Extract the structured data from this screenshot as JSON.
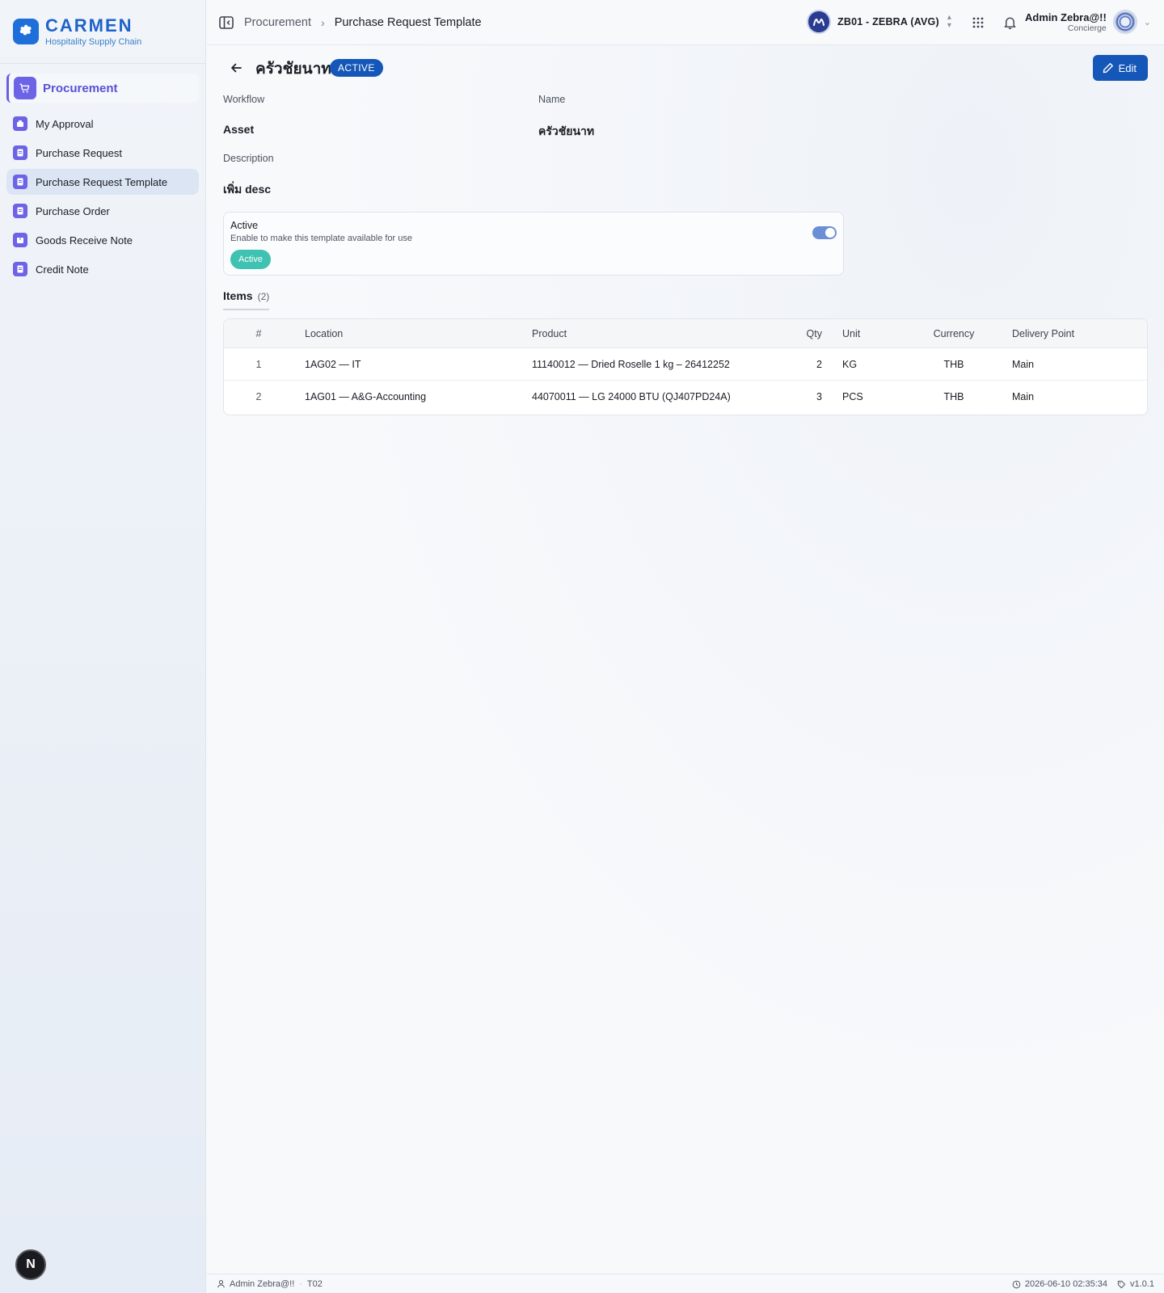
{
  "brand": {
    "name": "CARMEN",
    "tagline": "Hospitality Supply Chain"
  },
  "sidebar": {
    "group_label": "Procurement",
    "items": [
      {
        "label": "My Approval",
        "active": false
      },
      {
        "label": "Purchase Request",
        "active": false
      },
      {
        "label": "Purchase Request Template",
        "active": true
      },
      {
        "label": "Purchase Order",
        "active": false
      },
      {
        "label": "Goods Receive Note",
        "active": false
      },
      {
        "label": "Credit Note",
        "active": false
      }
    ],
    "badge_letter": "N"
  },
  "topbar": {
    "breadcrumb": [
      "Procurement",
      "Purchase Request Template"
    ],
    "business_unit": "ZB01 - ZEBRA (AVG)",
    "user_name": "Admin Zebra@!!",
    "user_role": "Concierge"
  },
  "page": {
    "title": "ครัวชัยนาท",
    "status": "ACTIVE",
    "edit_label": "Edit",
    "fields": {
      "workflow_label": "Workflow",
      "workflow_value": "Asset",
      "name_label": "Name",
      "name_value": "ครัวชัยนาท",
      "description_label": "Description",
      "description_value": "เพิ่ม desc"
    },
    "active_card": {
      "title": "Active",
      "description": "Enable to make this template available for use",
      "badge": "Active",
      "toggle_on": true
    },
    "items_title": "Items",
    "items_count": "(2)",
    "table": {
      "headers": [
        "#",
        "Location",
        "Product",
        "Qty",
        "Unit",
        "Currency",
        "Delivery Point"
      ],
      "rows": [
        {
          "no": "1",
          "location": "1AG02 — IT",
          "product": "11140012 — Dried Roselle 1 kg – 26412252",
          "qty": "2",
          "unit": "KG",
          "currency": "THB",
          "delivery_point": "Main"
        },
        {
          "no": "2",
          "location": "1AG01 — A&G-Accounting",
          "product": "44070011 — LG 24000 BTU (QJ407PD24A)",
          "qty": "3",
          "unit": "PCS",
          "currency": "THB",
          "delivery_point": "Main"
        }
      ]
    }
  },
  "footer": {
    "user": "Admin Zebra@!!",
    "code": "T02",
    "timestamp": "2026-06-10 02:35:34",
    "version": "v1.0.1"
  },
  "colors": {
    "primary": "#1557b8",
    "brand": "#1e63c9",
    "accent_purple": "#6c63e6",
    "active_badge": "#3fc2b1"
  },
  "icons": [
    "panel-toggle-icon",
    "chevron-right-icon",
    "apps-grid-icon",
    "bell-icon",
    "back-arrow-icon",
    "pencil-icon",
    "user-icon",
    "clock-icon",
    "tag-icon"
  ]
}
